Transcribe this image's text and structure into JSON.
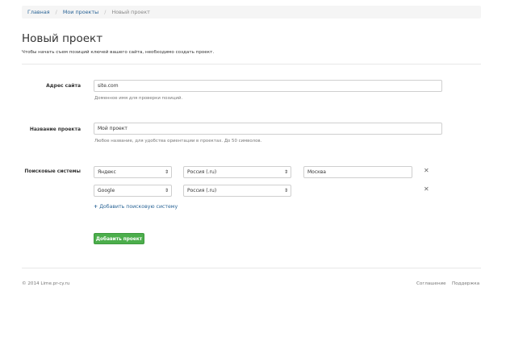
{
  "breadcrumb": {
    "home": "Главная",
    "projects": "Мои проекты",
    "current": "Новый проект"
  },
  "page": {
    "title": "Новый проект",
    "subtitle": "Чтобы начать съем позиций ключей вашего сайта, необходимо создать проект."
  },
  "form": {
    "site": {
      "label": "Адрес сайта",
      "value": "site.com",
      "help": "Доменное имя для проверки позиций."
    },
    "name": {
      "label": "Название проекта",
      "value": "Мой проект",
      "help": "Любое название, для удобства ориентации в проектах. До 50 символов."
    },
    "engines": {
      "label": "Поисковые системы",
      "rows": [
        {
          "engine": "Яндекс",
          "region": "Россия (.ru)",
          "city": "Москва"
        },
        {
          "engine": "Google",
          "region": "Россия (.ru)"
        }
      ],
      "add_label": "Добавить поисковую систему"
    },
    "submit_label": "Добавить проект"
  },
  "footer": {
    "copyright": "© 2014 Lime.pr-cy.ru",
    "agreement": "Соглашение",
    "support": "Поддержка"
  },
  "icons": {
    "select_arrow": "sort-arrows-icon",
    "remove": "close-icon",
    "add": "plus-icon"
  },
  "colors": {
    "link": "#2a6496",
    "primary_button": "#4cae4c"
  }
}
